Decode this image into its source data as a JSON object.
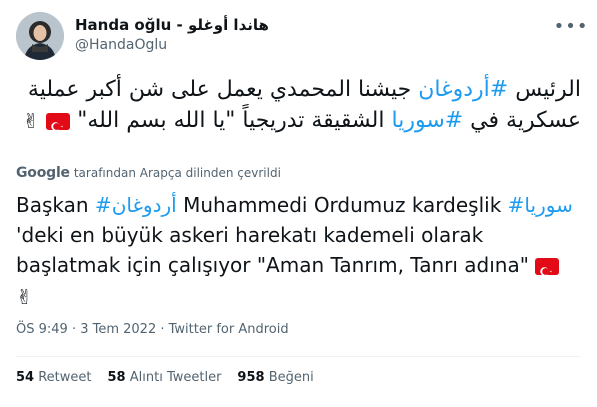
{
  "author": {
    "name": "Handa oğlu - هاندا أوغلو",
    "handle": "@HandaOglu"
  },
  "tweet": {
    "original": {
      "text1": "الرئيس ",
      "hashtag1": "#أردوغان",
      "text2": " جيشنا المحمدي يعمل على شن أكبر عملية عسكرية في ",
      "hashtag2": "#سوريا",
      "text3": " الشقيقة تدريجياً \"يا الله بسم الله\" "
    },
    "translated_by": {
      "brand": "Google",
      "label": "tarafından Arapça dilinden çevrildi"
    },
    "translated": {
      "text1": "Başkan ",
      "hashtag1": "#أردوغان",
      "text2": " Muhammedi Ordumuz kardeşlik ",
      "hashtag2": "#سوريا",
      "text3": " 'deki en büyük askeri harekatı kademeli olarak başlatmak için çalışıyor \"Aman Tanrım, Tanrı adına\" "
    },
    "emojis": [
      "turkey-flag",
      "victory-hand"
    ],
    "meta": "ÖS 9:49 · 3 Tem 2022 · Twitter for Android"
  },
  "stats": {
    "retweets_count": "54",
    "retweets_label": "Retweet",
    "quotes_count": "58",
    "quotes_label": "Alıntı Tweetler",
    "likes_count": "958",
    "likes_label": "Beğeni"
  },
  "colors": {
    "hashtag": "#1d9bf0",
    "secondary": "#536471",
    "flag_red": "#e30a17"
  }
}
